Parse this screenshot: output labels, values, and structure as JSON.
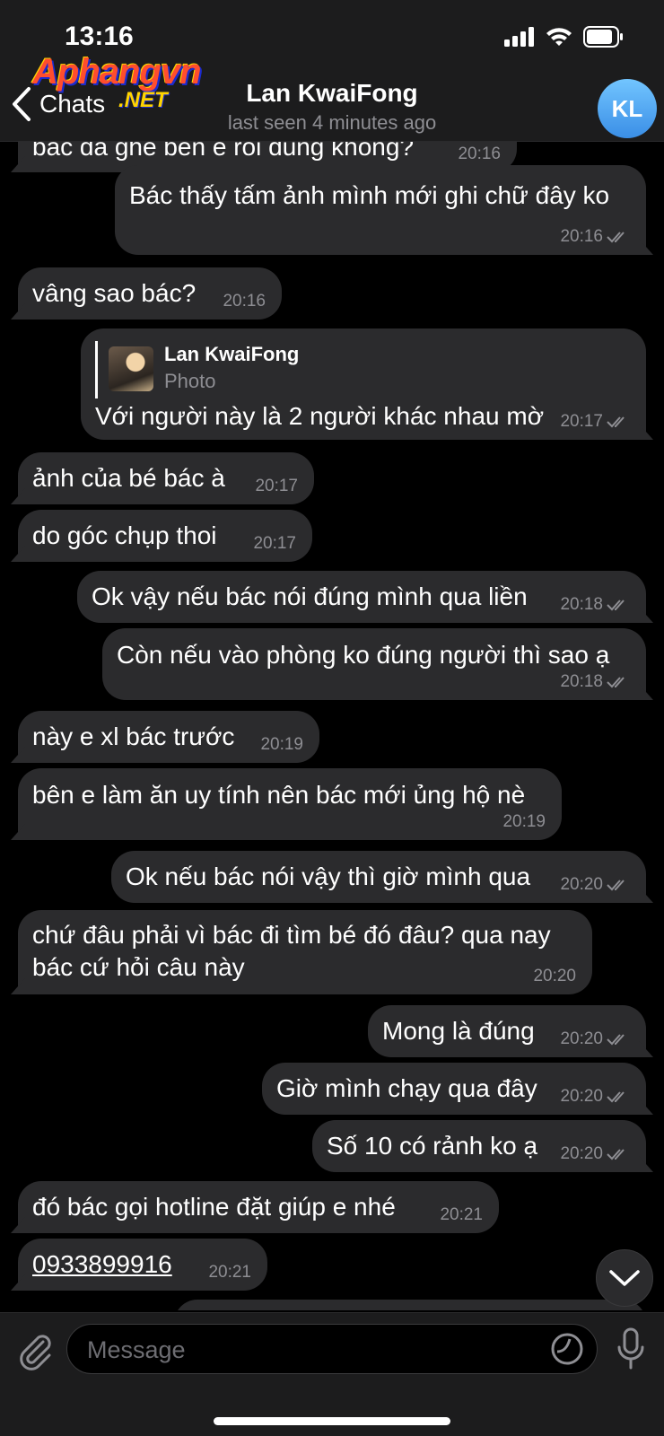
{
  "status_bar": {
    "time": "13:16"
  },
  "header": {
    "back_label": "Chats",
    "watermark_line1": "Aphangvn",
    "watermark_line2": ".NET",
    "chat_name": "Lan KwaiFong",
    "chat_status": "last seen 4 minutes ago",
    "avatar_initials": "KL"
  },
  "messages": [
    {
      "dir": "in",
      "text": "bác đã ghé bên e rồi đúng không?",
      "time": "20:16"
    },
    {
      "dir": "out",
      "text": "Bác thấy tấm ảnh mình mới ghi chữ đây ko",
      "time": "20:16"
    },
    {
      "dir": "in",
      "text": "vâng sao bác?",
      "time": "20:16"
    },
    {
      "dir": "out",
      "text": "Với người này là 2 người khác nhau mờ",
      "time": "20:17",
      "reply_name": "Lan KwaiFong",
      "reply_type": "Photo"
    },
    {
      "dir": "in",
      "text": "ảnh của bé bác à",
      "time": "20:17"
    },
    {
      "dir": "in",
      "text": "do góc chụp thoi",
      "time": "20:17"
    },
    {
      "dir": "out",
      "text": "Ok vậy nếu bác nói đúng mình qua liền",
      "time": "20:18"
    },
    {
      "dir": "out",
      "text": "Còn nếu vào phòng ko đúng người thì sao ạ",
      "time": "20:18"
    },
    {
      "dir": "in",
      "text": "này e xl bác trước",
      "time": "20:19"
    },
    {
      "dir": "in",
      "text": "bên e làm ăn uy tính nên bác mới ủng hộ nè",
      "time": "20:19"
    },
    {
      "dir": "out",
      "text": "Ok nếu bác nói vậy thì giờ mình qua",
      "time": "20:20"
    },
    {
      "dir": "in",
      "text": "chứ đâu phải vì bác đi tìm bé đó đâu? qua nay",
      "text2": "bác cứ hỏi câu này",
      "time": "20:20"
    },
    {
      "dir": "out",
      "text": "Mong là đúng",
      "time": "20:20"
    },
    {
      "dir": "out",
      "text": "Giờ mình chạy qua đây",
      "time": "20:20"
    },
    {
      "dir": "out",
      "text": "Số 10 có rảnh ko ạ",
      "time": "20:20"
    },
    {
      "dir": "in",
      "text": "đó bác gọi hotline đặt giúp e nhé",
      "time": "20:21"
    },
    {
      "dir": "in",
      "text": "0933899916",
      "time": "20:21"
    }
  ],
  "composer": {
    "placeholder": "Message"
  },
  "icons": {
    "back": "chevron-left-icon",
    "attach": "paperclip-icon",
    "sticker": "sticker-icon",
    "mic": "microphone-icon",
    "scroll": "chevron-down-icon",
    "read": "double-check-icon"
  },
  "colors": {
    "background": "#000000",
    "bubble": "#2b2b2d",
    "header": "#1c1c1d",
    "meta_text": "#8e8e93",
    "avatar": "#4aa3f0"
  }
}
